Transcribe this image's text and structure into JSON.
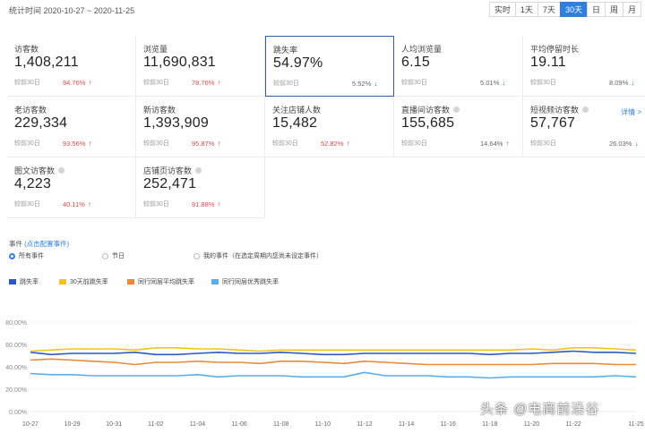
{
  "header": {
    "date_range": "统计时间 2020-10-27 ~ 2020-11-25",
    "ranges": [
      "实时",
      "1天",
      "7天",
      "30天",
      "日",
      "周",
      "月"
    ],
    "active_range": 3
  },
  "metrics": [
    {
      "label": "访客数",
      "value": "1,408,211",
      "compare": "较前30日",
      "pct": "94.76%",
      "trend": "up",
      "help": false
    },
    {
      "label": "浏览量",
      "value": "11,690,831",
      "compare": "较前30日",
      "pct": "78.76%",
      "trend": "up",
      "help": false
    },
    {
      "label": "跳失率",
      "value": "54.97%",
      "compare": "较前30日",
      "pct": "5.52%",
      "trend": "down",
      "help": false
    },
    {
      "label": "人均浏览量",
      "value": "6.15",
      "compare": "较前30日",
      "pct": "5.01%",
      "trend": "down",
      "help": false
    },
    {
      "label": "平均停留时长",
      "value": "19.11",
      "compare": "较前30日",
      "pct": "8.09%",
      "trend": "down",
      "help": false
    },
    {
      "label": "老访客数",
      "value": "229,334",
      "compare": "较前30日",
      "pct": "93.56%",
      "trend": "up",
      "help": false
    },
    {
      "label": "新访客数",
      "value": "1,393,909",
      "compare": "较前30日",
      "pct": "95.87%",
      "trend": "up",
      "help": false
    },
    {
      "label": "关注店铺人数",
      "value": "15,482",
      "compare": "较前30日",
      "pct": "52.82%",
      "trend": "up",
      "help": false
    },
    {
      "label": "直播间访客数",
      "value": "155,685",
      "compare": "较前30日",
      "pct": "14.64%",
      "trend": "up",
      "help": true
    },
    {
      "label": "短视频访客数",
      "value": "57,767",
      "compare": "较前30日",
      "pct": "26.03%",
      "trend": "down",
      "help": true
    },
    {
      "label": "图文访客数",
      "value": "4,223",
      "compare": "较前30日",
      "pct": "40.11%",
      "trend": "up",
      "help": true
    },
    {
      "label": "店铺页访客数",
      "value": "252,471",
      "compare": "较前30日",
      "pct": "91.88%",
      "trend": "up",
      "help": true
    }
  ],
  "detail_link": "详情 >",
  "events": {
    "title": "事件",
    "config_link": "(点击配置事件)",
    "options": [
      "所有事件",
      "节日",
      "我的事件（在选定周期内您尚未设定事件）"
    ],
    "selected": 0
  },
  "colors": {
    "accent": "#2f7fe0",
    "up": "#d94a4a",
    "down": "#1aa04a",
    "series": [
      "#2b59c3",
      "#f0c419",
      "#e88a3a",
      "#5aaee8"
    ]
  },
  "chart_data": {
    "type": "line",
    "x": [
      "10-27",
      "10-28",
      "10-29",
      "10-30",
      "10-31",
      "11-01",
      "11-02",
      "11-03",
      "11-04",
      "11-05",
      "11-06",
      "11-07",
      "11-08",
      "11-09",
      "11-10",
      "11-11",
      "11-12",
      "11-13",
      "11-14",
      "11-15",
      "11-16",
      "11-17",
      "11-18",
      "11-19",
      "11-20",
      "11-21",
      "11-22",
      "11-23",
      "11-24",
      "11-25"
    ],
    "x_tick_labels": [
      "10-27",
      "10-29",
      "10-31",
      "11-02",
      "11-04",
      "11-06",
      "11-08",
      "11-10",
      "11-12",
      "11-14",
      "11-16",
      "11-18",
      "11-20",
      "11-22",
      "11-25"
    ],
    "y_tick_labels": [
      "0.00%",
      "20.00%",
      "40.00%",
      "60.00%",
      "80.00%"
    ],
    "ylim": [
      0,
      80
    ],
    "grid": true,
    "series": [
      {
        "name": "跳失率",
        "values": [
          53,
          51,
          52,
          52,
          52,
          53,
          51,
          51,
          52,
          53,
          52,
          52,
          53,
          52,
          51,
          51,
          52,
          52,
          52,
          52,
          52,
          52,
          51,
          52,
          52,
          53,
          54,
          53,
          53,
          52
        ]
      },
      {
        "name": "30天前跳失率",
        "values": [
          54,
          55,
          56,
          56,
          56,
          55,
          57,
          57,
          56,
          56,
          55,
          54,
          55,
          55,
          55,
          55,
          55,
          55,
          55,
          55,
          55,
          55,
          55,
          55,
          56,
          55,
          57,
          57,
          56,
          55
        ]
      },
      {
        "name": "同行同层平均跳失率",
        "values": [
          46,
          47,
          46,
          45,
          44,
          42,
          44,
          44,
          45,
          44,
          44,
          43,
          45,
          45,
          44,
          43,
          45,
          44,
          43,
          42,
          42,
          42,
          42,
          42,
          42,
          43,
          43,
          43,
          42,
          42
        ]
      },
      {
        "name": "同行同层优秀跳失率",
        "values": [
          34,
          33,
          33,
          32,
          32,
          32,
          32,
          32,
          33,
          31,
          32,
          32,
          32,
          31,
          31,
          31,
          35,
          32,
          32,
          32,
          31,
          31,
          30,
          31,
          31,
          31,
          31,
          31,
          32,
          31
        ]
      }
    ]
  },
  "watermark": "头条 @电商前沿谷"
}
